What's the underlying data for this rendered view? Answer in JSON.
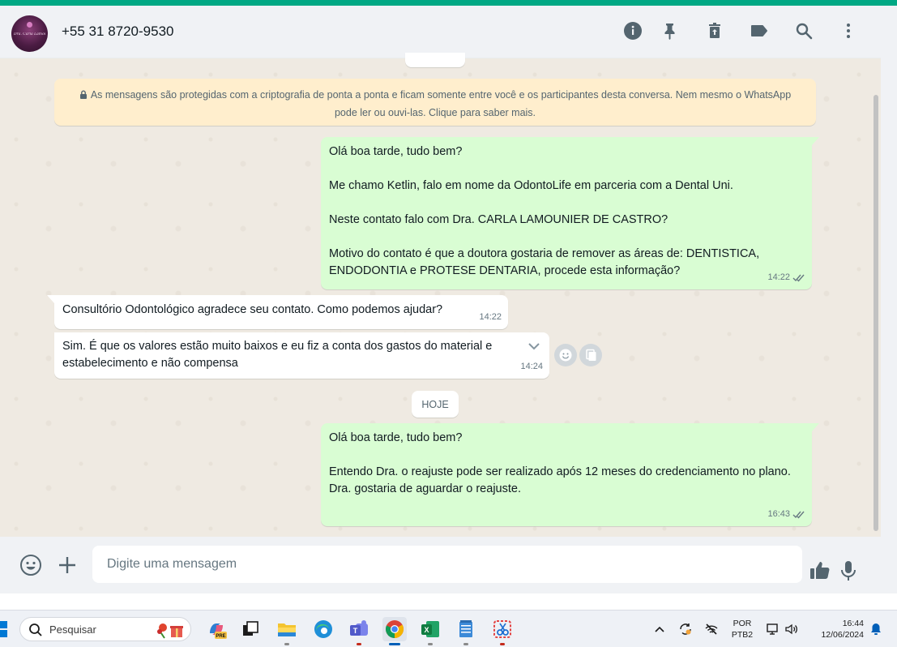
{
  "header": {
    "contact_name": "+55 31 8720-9530",
    "avatar_text": "Dra. Carla Lamounier",
    "icons": [
      "info-icon",
      "pin-icon",
      "delete-icon",
      "label-icon",
      "search-icon",
      "menu-icon"
    ]
  },
  "encryption_notice": {
    "text": "As mensagens são protegidas com a criptografia de ponta a ponta e ficam somente entre você e os participantes desta conversa. Nem mesmo o WhatsApp pode ler ou ouvi-las. Clique para saber mais."
  },
  "messages": [
    {
      "direction": "outgoing",
      "text": "Olá boa tarde, tudo bem?\n\nMe chamo Ketlin, falo em nome da OdontoLife em parceria com a Dental Uni.\n\nNeste contato falo com Dra. CARLA LAMOUNIER DE CASTRO?\n\nMotivo do contato é que a doutora gostaria de remover as áreas de: DENTISTICA, ENDODONTIA e PROTESE DENTARIA, procede esta informação?",
      "time": "14:22",
      "status": "read"
    },
    {
      "direction": "incoming",
      "text": "Consultório Odontológico agradece seu contato. Como podemos ajudar?",
      "time": "14:22"
    },
    {
      "direction": "incoming",
      "text": "Sim. É que os valores estão muito baixos e eu fiz a conta dos gastos do material e estabelecimento e não compensa",
      "time": "14:24"
    },
    {
      "direction": "outgoing",
      "text": "Olá boa tarde, tudo bem?\n\nEntendo Dra. o reajuste pode ser realizado após 12 meses do credenciamento no plano.\nDra. gostaria de aguardar o reajuste.",
      "time": "16:43",
      "status": "read"
    }
  ],
  "date_divider": "HOJE",
  "composer": {
    "placeholder": "Digite uma mensagem"
  },
  "taskbar": {
    "search_label": "Pesquisar",
    "language_line1": "POR",
    "language_line2": "PTB2",
    "time": "16:44",
    "date": "12/06/2024"
  },
  "colors": {
    "accent": "#00a884",
    "outgoing_bubble": "#d9fdd3",
    "incoming_bubble": "#ffffff",
    "notice_bg": "#ffeecd",
    "read_tick": "#667781"
  }
}
